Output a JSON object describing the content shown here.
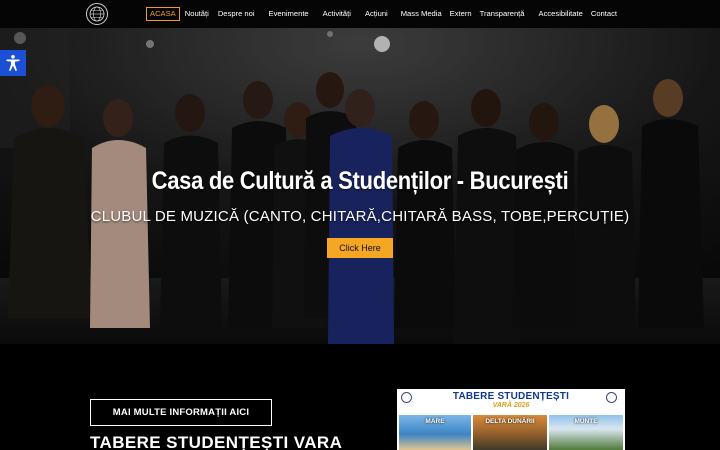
{
  "nav": {
    "items": [
      {
        "label": "ACASA",
        "active": true
      },
      {
        "label": "Noutăți"
      },
      {
        "label": "Despre noi"
      },
      {
        "label": "Evenimente"
      },
      {
        "label": "Activități"
      },
      {
        "label": "Acțiuni"
      },
      {
        "label": "Mass Media"
      },
      {
        "label": "Extern"
      },
      {
        "label": "Transparență"
      },
      {
        "label": "Accesibilitate"
      },
      {
        "label": "Contact"
      }
    ]
  },
  "accessibility": {
    "icon": "accessibility-icon",
    "color": "#1b4fd6"
  },
  "hero": {
    "title": "Casa de Cultură a Studenților - București",
    "subtitle": "CLUBUL DE MUZICĂ (CANTO, CHITARĂ,CHITARĂ BASS, TOBE,PERCUȚIE)",
    "cta_label": "Click Here",
    "cta_color": "#f5a623"
  },
  "lower": {
    "more_info_label": "MAI MULTE INFORMAȚII AICI",
    "heading": "TABERE STUDENȚEȘTI VARA"
  },
  "poster": {
    "title": "TABERE STUDENȚEȘTI",
    "subtitle": "VARĂ 2026",
    "panels": [
      "MARE",
      "DELTA DUNĂRII",
      "MUNTE"
    ]
  }
}
